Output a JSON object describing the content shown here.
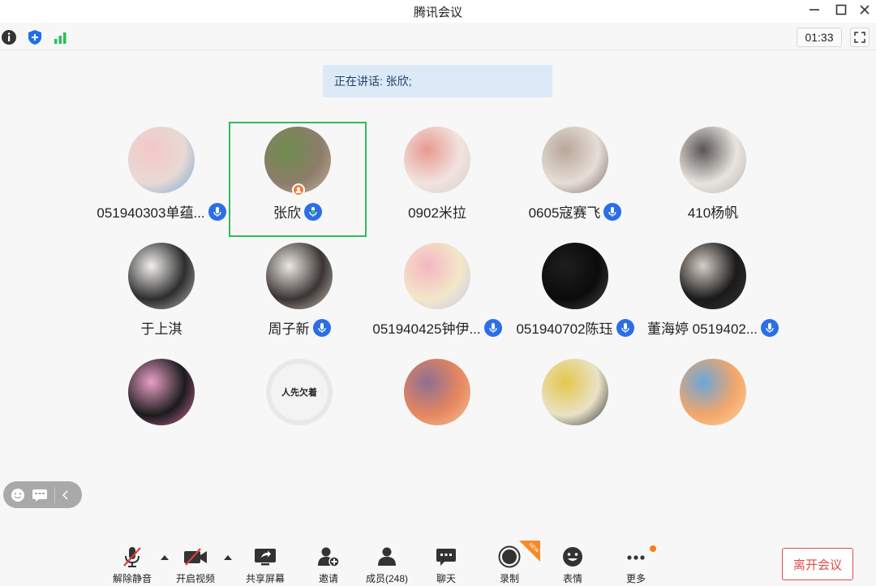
{
  "window": {
    "title": "腾讯会议"
  },
  "top_toolbar": {
    "timer": "01:33"
  },
  "speaking": {
    "text": "正在讲话: 张欣;"
  },
  "participants": [
    {
      "name": "051940303单蕴...",
      "mic": "on",
      "active": false,
      "avatar_colors": [
        "#e8d9d4",
        "#f4c7c9",
        "#6fa8d6"
      ]
    },
    {
      "name": "张欣",
      "mic": "speaking",
      "active": true,
      "host": true,
      "avatar_colors": [
        "#8b7d6a",
        "#6f8c4e",
        "#c7b39a"
      ]
    },
    {
      "name": "0902米拉",
      "mic": "none",
      "active": false,
      "avatar_colors": [
        "#f1e3df",
        "#e89a8f",
        "#d9cfc8"
      ]
    },
    {
      "name": "0605寇赛飞",
      "mic": "on",
      "active": false,
      "avatar_colors": [
        "#e5ddd6",
        "#b9a69a",
        "#7b6a62"
      ]
    },
    {
      "name": "410杨帆",
      "mic": "none",
      "active": false,
      "avatar_colors": [
        "#e7e4df",
        "#5a5555",
        "#bcb3ac"
      ]
    },
    {
      "name": "于上淇",
      "mic": "none",
      "active": false,
      "avatar_colors": [
        "#2d2d2d",
        "#f2f0ee",
        "#bdb9b6"
      ]
    },
    {
      "name": "周子新",
      "mic": "on",
      "active": false,
      "avatar_colors": [
        "#3a3533",
        "#ece8e2",
        "#c9c3bb"
      ]
    },
    {
      "name": "051940425钟伊...",
      "mic": "on",
      "active": false,
      "avatar_colors": [
        "#f3e7c9",
        "#f4b6c2",
        "#c7c7ee"
      ]
    },
    {
      "name": "051940702陈珏",
      "mic": "on",
      "active": false,
      "avatar_colors": [
        "#0b0b0b",
        "#1e1e1e",
        "#4a4a4a"
      ]
    },
    {
      "name": "董海婷 0519402...",
      "mic": "on",
      "active": false,
      "avatar_colors": [
        "#1a1a1a",
        "#d8cfc8",
        "#3b3535"
      ]
    },
    {
      "name": "",
      "mic": "none",
      "active": false,
      "avatar_colors": [
        "#1b1b1b",
        "#e9a0c7",
        "#d06ea6"
      ]
    },
    {
      "name": "",
      "mic": "none",
      "active": false,
      "avatar_text": "人先欠着",
      "avatar_colors": [
        "#f2f2f2",
        "#e6e6e6",
        "#dadada"
      ]
    },
    {
      "name": "",
      "mic": "none",
      "active": false,
      "avatar_colors": [
        "#e7875f",
        "#8f6f91",
        "#f3c7a0"
      ]
    },
    {
      "name": "",
      "mic": "none",
      "active": false,
      "avatar_colors": [
        "#e9e2c8",
        "#e4c64a",
        "#2a2a2a"
      ]
    },
    {
      "name": "",
      "mic": "none",
      "active": false,
      "avatar_colors": [
        "#f4a66a",
        "#6ba6d9",
        "#f5d9a8"
      ]
    }
  ],
  "bottom_bar": {
    "unmute": "解除静音",
    "start_video": "开启视频",
    "share_screen": "共享屏幕",
    "invite": "邀请",
    "members": "成员(248)",
    "chat": "聊天",
    "record": "录制",
    "record_tag": "NEW",
    "reactions": "表情",
    "more": "更多",
    "leave": "离开会议"
  },
  "colors": {
    "active_border": "#2ebd5a",
    "accent_blue": "#2b6ee8",
    "leave_red": "#e04b4b",
    "notice_bg": "#dce9f7"
  }
}
